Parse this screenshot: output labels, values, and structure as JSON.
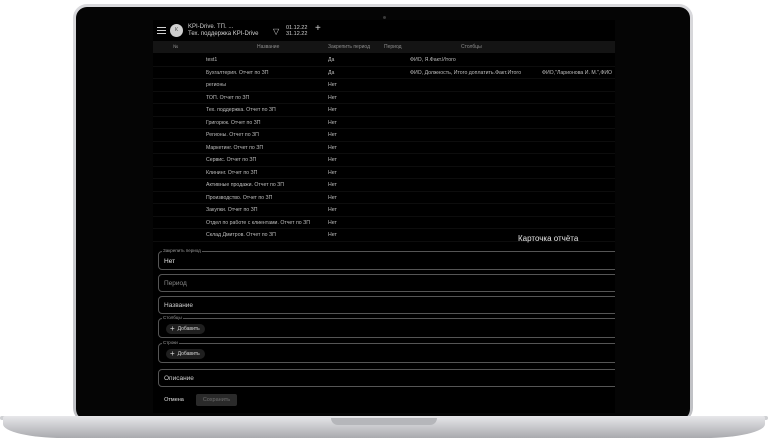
{
  "header": {
    "avatar_letter": "К",
    "app_title": "KPI-Drive. ТП. ...",
    "app_subtitle": "Тех. поддержка KPI-Drive",
    "date_from": "01.12.22",
    "date_to": "31.12.22"
  },
  "table": {
    "headers": {
      "num": "№",
      "name": "Название",
      "fix": "Закрепить период",
      "period": "Период",
      "columns": "Столбцы"
    },
    "rows": [
      {
        "name": "test1",
        "fix": "Да",
        "columns": "ФИО, Я.Факт.Итого",
        "columns2": ""
      },
      {
        "name": "Бухгалтерия. Отчет по ЗП",
        "fix": "Да",
        "columns": "ФИО, Должность, Итого доплатить.Факт.Итого",
        "columns2": "ФИО,\"Ларионова И. М.\",ФИО"
      },
      {
        "name": "регионы",
        "fix": "Нет",
        "columns": "",
        "columns2": ""
      },
      {
        "name": "ТОП. Отчет по ЗП",
        "fix": "Нет",
        "columns": "",
        "columns2": ""
      },
      {
        "name": "Тех. поддержка. Отчет по ЗП",
        "fix": "Нет",
        "columns": "",
        "columns2": ""
      },
      {
        "name": "Григорюк. Отчет по ЗП",
        "fix": "Нет",
        "columns": "",
        "columns2": ""
      },
      {
        "name": "Регионы. Отчет по ЗП",
        "fix": "Нет",
        "columns": "",
        "columns2": ""
      },
      {
        "name": "Маркетинг. Отчет по ЗП",
        "fix": "Нет",
        "columns": "",
        "columns2": ""
      },
      {
        "name": "Сервис. Отчет по ЗП",
        "fix": "Нет",
        "columns": "",
        "columns2": ""
      },
      {
        "name": "Клининг. Отчет по ЗП",
        "fix": "Нет",
        "columns": "",
        "columns2": ""
      },
      {
        "name": "Активные продажи. Отчет по ЗП",
        "fix": "Нет",
        "columns": "",
        "columns2": ""
      },
      {
        "name": "Производство. Отчет по ЗП",
        "fix": "Нет",
        "columns": "",
        "columns2": ""
      },
      {
        "name": "Закупки. Отчет по ЗП",
        "fix": "Нет",
        "columns": "",
        "columns2": ""
      },
      {
        "name": "Отдел по работе с клиентами. Отчет по ЗП",
        "fix": "Нет",
        "columns": "",
        "columns2": ""
      },
      {
        "name": "Склад Дмитров. Отчет по ЗП",
        "fix": "Нет",
        "columns": "",
        "columns2": ""
      }
    ]
  },
  "form": {
    "card_title": "Карточка отчёта",
    "fix_period_label": "Закрепить период",
    "fix_period_value": "Нет",
    "period_placeholder": "Период",
    "name_placeholder": "Название",
    "columns_label": "Столбцы",
    "rows_label": "Строки",
    "add_label": "Добавить",
    "description_placeholder": "Описание",
    "cancel_label": "Отмена",
    "save_label": "Сохранить"
  }
}
